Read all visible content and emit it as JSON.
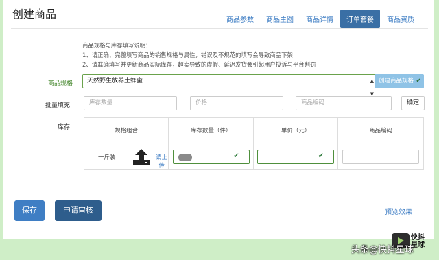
{
  "page": {
    "title": "创建商品",
    "tabs": [
      {
        "label": "商品参数",
        "active": false
      },
      {
        "label": "商品主图",
        "active": false
      },
      {
        "label": "商品详情",
        "active": false
      },
      {
        "label": "订单套餐",
        "active": true
      },
      {
        "label": "商品资质",
        "active": false
      }
    ]
  },
  "notes": {
    "heading": "商品规格与库存填写说明：",
    "line1": "1、请正确、完整填写商品的销售规格与属性，错误及不规范的填写会导致商品下架",
    "line2": "2、请准确填写并更新商品实际库存，超卖导致的虚假、延迟发货会引起用户投诉与平台判罚"
  },
  "spec": {
    "label": "商品规格",
    "value": "天然野生放养土蜂蜜",
    "create_button": "创建商品规格"
  },
  "batch": {
    "label": "批量填充",
    "stock_placeholder": "库存数量",
    "price_placeholder": "价格",
    "code_placeholder": "商品编码",
    "confirm": "确定"
  },
  "stock": {
    "label": "库存",
    "headers": [
      "规格组合",
      "库存数量（件）",
      "单价（元）",
      "商品编码"
    ],
    "rows": [
      {
        "spec": "一斤装",
        "upload_link": "请上传"
      }
    ]
  },
  "footer": {
    "save": "保存",
    "submit_review": "申请审核",
    "preview": "预览效果"
  },
  "watermark": {
    "brand": "快抖\n星球",
    "text": "头条@快抖星球"
  },
  "colors": {
    "accent": "#3f7ec4",
    "active_tab": "#3a6fa5",
    "valid_green": "#4f8f3c",
    "background": "#cfeec7"
  }
}
